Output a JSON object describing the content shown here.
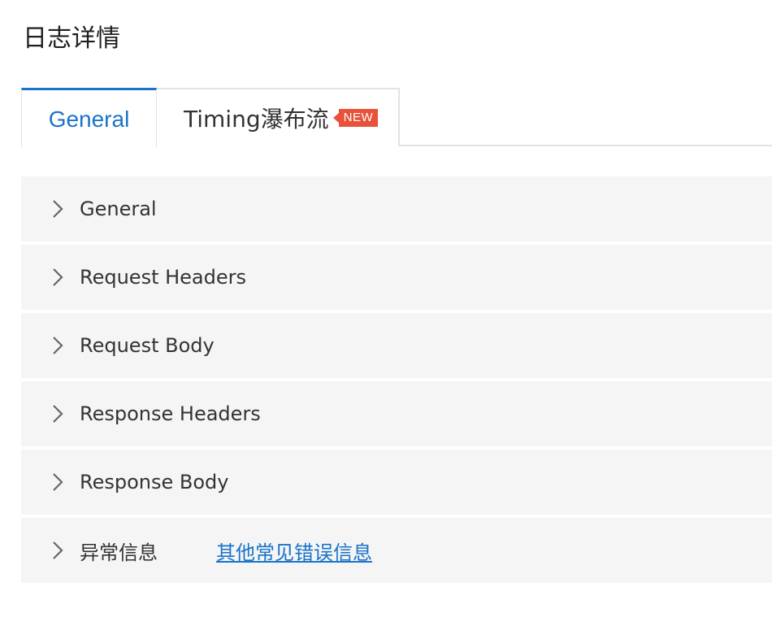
{
  "page": {
    "title": "日志详情"
  },
  "tabs": [
    {
      "label": "General",
      "active": true
    },
    {
      "label": "Timing瀑布流",
      "active": false,
      "badge": "NEW"
    }
  ],
  "panels": [
    {
      "label": "General",
      "expanded": false
    },
    {
      "label": "Request Headers",
      "expanded": false
    },
    {
      "label": "Request Body",
      "expanded": false
    },
    {
      "label": "Response Headers",
      "expanded": false
    },
    {
      "label": "Response Body",
      "expanded": false
    },
    {
      "label": "异常信息",
      "expanded": false,
      "link": "其他常见错误信息"
    }
  ],
  "icons": {
    "panel_toggle": "chevron-right-icon"
  },
  "colors": {
    "accent": "#1a73c9",
    "badge": "#e8523b",
    "panel_bg": "#f5f5f5"
  }
}
